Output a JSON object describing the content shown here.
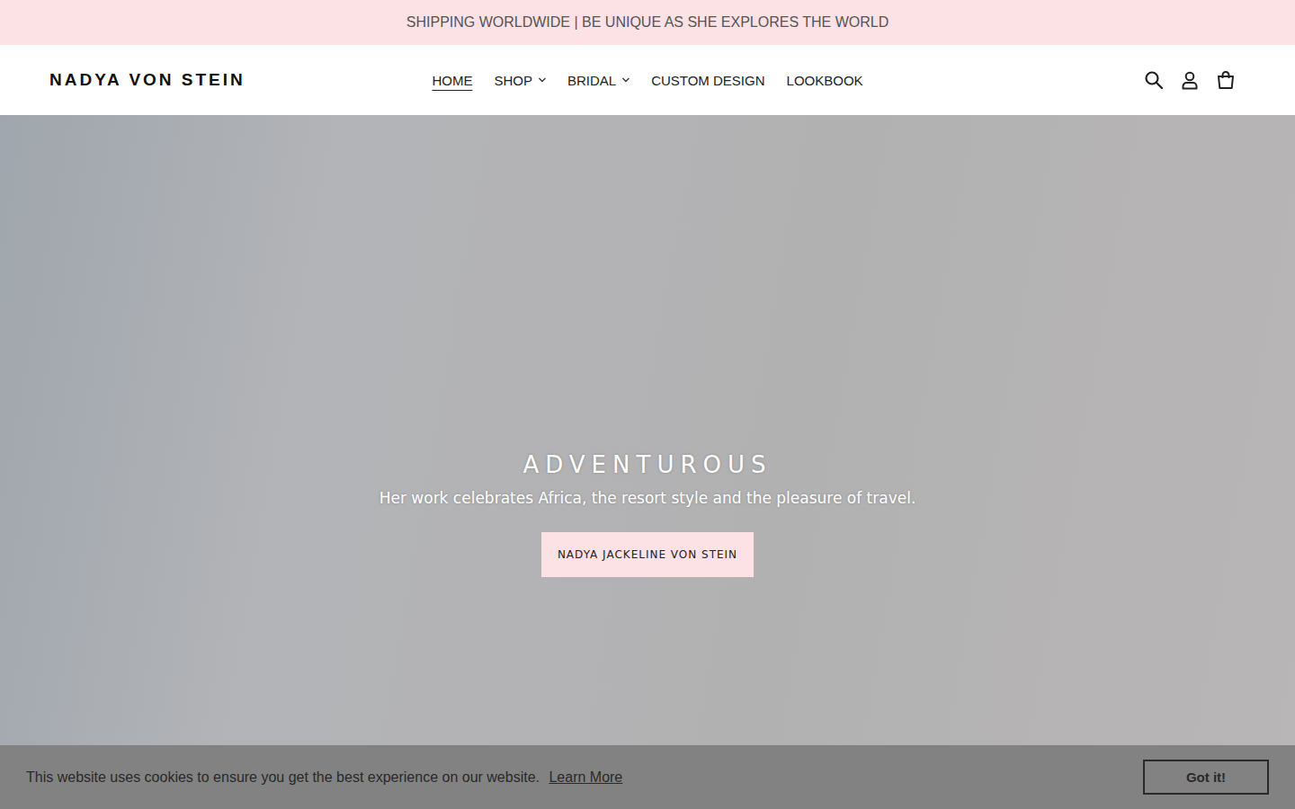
{
  "announcement": "SHIPPING WORLDWIDE | BE UNIQUE AS SHE EXPLORES THE WORLD",
  "header": {
    "logo": "NADYA VON STEIN",
    "nav": [
      {
        "label": "HOME",
        "selected": true,
        "dropdown": false
      },
      {
        "label": "SHOP",
        "selected": false,
        "dropdown": true
      },
      {
        "label": "BRIDAL",
        "selected": false,
        "dropdown": true
      },
      {
        "label": "CUSTOM DESIGN",
        "selected": false,
        "dropdown": false
      },
      {
        "label": "LOOKBOOK",
        "selected": false,
        "dropdown": false
      }
    ]
  },
  "hero": {
    "title": "ADVENTUROUS",
    "subtitle": "Her work celebrates Africa, the resort style and the pleasure of travel.",
    "button": "NADYA JACKELINE VON STEIN"
  },
  "cookie_banner": {
    "message": "This website uses cookies to ensure you get the best experience on our website.",
    "link": "Learn More",
    "button": "Got it!"
  }
}
